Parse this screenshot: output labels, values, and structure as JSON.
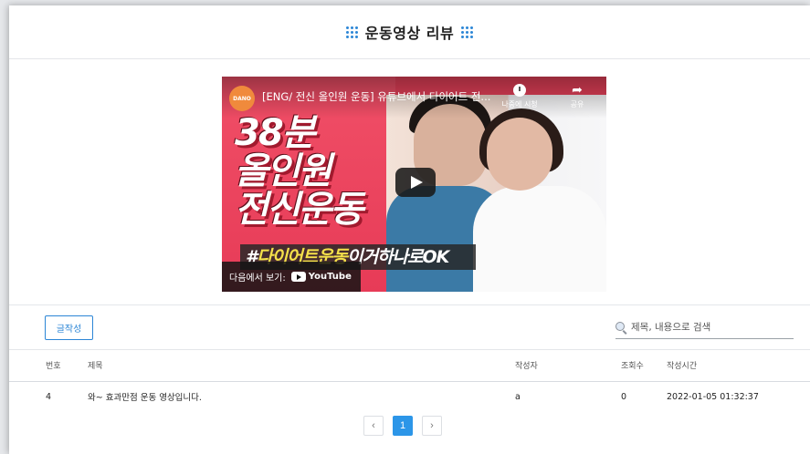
{
  "header": {
    "title": "운동영상 리뷰"
  },
  "video": {
    "channel": "DANO",
    "title": "[ENG/ 전신 올인원 운동] 유튜브에서 다이어트 전...",
    "watch_later": "나중에 시청",
    "share": "공유",
    "thumb_line1": "38분",
    "thumb_line2": "올인원",
    "thumb_line3": "전신운동",
    "banner_prefix": "#",
    "banner_highlight": "다이어트운동",
    "banner_suffix": "이거하나로OK",
    "watch_on": "다음에서 보기:",
    "youtube_label": "YouTube"
  },
  "toolbar": {
    "write_label": "글작성",
    "search_placeholder": "제목, 내용으로 검색"
  },
  "table": {
    "headers": {
      "no": "번호",
      "title": "제목",
      "author": "작성자",
      "views": "조회수",
      "time": "작성시간"
    },
    "rows": [
      {
        "no": "4",
        "title": "와~ 효과만점 운동 영상입니다.",
        "author": "a",
        "views": "0",
        "time": "2022-01-05 01:32:37"
      }
    ]
  },
  "pagination": {
    "prev": "‹",
    "current": "1",
    "next": "›"
  },
  "colors": {
    "accent": "#2c86d6",
    "active_page": "#2c96e8",
    "thumb_bg": "#e9415a"
  }
}
